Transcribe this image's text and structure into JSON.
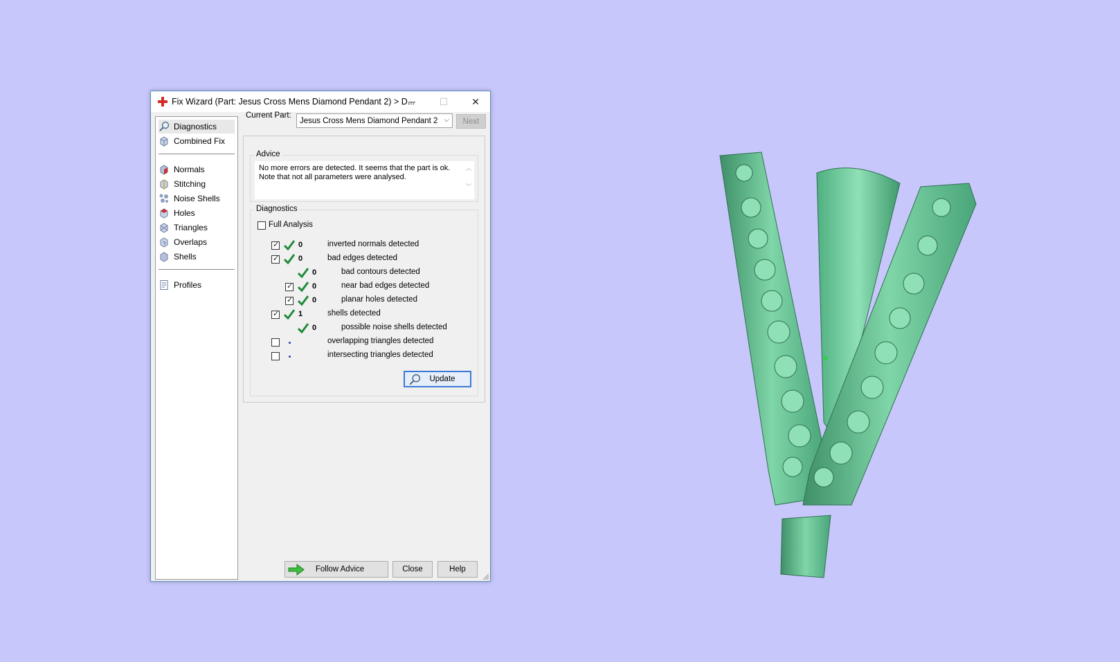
{
  "window": {
    "title": "Fix Wizard (Part: Jesus Cross Mens Diamond Pendant 2) > D...",
    "controls": {
      "minimize": "─",
      "maximize": "☐",
      "close": "✕"
    }
  },
  "sidebar": {
    "items": [
      {
        "label": "Diagnostics",
        "icon": "magnifier-icon"
      },
      {
        "label": "Combined Fix",
        "icon": "cube-icon"
      },
      {
        "label": "Normals",
        "icon": "normals-icon"
      },
      {
        "label": "Stitching",
        "icon": "stitching-icon"
      },
      {
        "label": "Noise Shells",
        "icon": "noise-shells-icon"
      },
      {
        "label": "Holes",
        "icon": "holes-icon"
      },
      {
        "label": "Triangles",
        "icon": "triangles-icon"
      },
      {
        "label": "Overlaps",
        "icon": "overlaps-icon"
      },
      {
        "label": "Shells",
        "icon": "shells-icon"
      },
      {
        "label": "Profiles",
        "icon": "profiles-icon"
      }
    ]
  },
  "current_part": {
    "label": "Current Part:",
    "value": "Jesus Cross Mens Diamond Pendant 2",
    "next_label": "Next"
  },
  "advice": {
    "title": "Advice",
    "line1": "No more errors are detected. It seems that the part is ok.",
    "line2": "Note that not all parameters were analysed."
  },
  "diagnostics": {
    "title": "Diagnostics",
    "full_analysis": "Full Analysis",
    "rows": [
      {
        "checked": true,
        "status": "ok",
        "count": "0",
        "text": "inverted normals detected"
      },
      {
        "checked": true,
        "status": "ok",
        "count": "0",
        "text": "bad edges detected"
      },
      {
        "checked": null,
        "status": "ok",
        "count": "0",
        "text": "bad contours detected"
      },
      {
        "checked": true,
        "status": "ok",
        "count": "0",
        "text": "near bad edges detected"
      },
      {
        "checked": true,
        "status": "ok",
        "count": "0",
        "text": "planar holes detected"
      },
      {
        "checked": true,
        "status": "ok",
        "count": "1",
        "text": "shells detected"
      },
      {
        "checked": null,
        "status": "ok",
        "count": "0",
        "text": "possible noise shells detected"
      },
      {
        "checked": false,
        "status": "pending",
        "count": "",
        "text": "overlapping triangles detected"
      },
      {
        "checked": false,
        "status": "pending",
        "count": "",
        "text": "intersecting triangles detected"
      }
    ],
    "update_label": "Update"
  },
  "footer": {
    "follow_advice": "Follow Advice",
    "close": "Close",
    "help": "Help"
  },
  "colors": {
    "background": "#c7c7fb",
    "model": "#6fcf9c",
    "check_green": "#1f8a3a"
  }
}
